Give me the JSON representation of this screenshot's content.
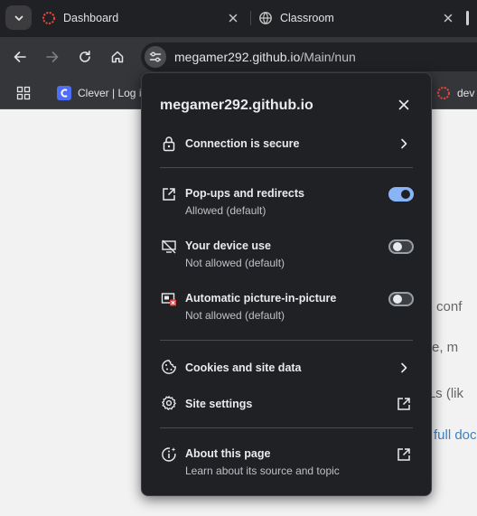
{
  "tabs": [
    {
      "title": "Dashboard",
      "icon": "dashboard-favicon"
    },
    {
      "title": "Classroom",
      "icon": "globe-icon"
    }
  ],
  "toolbar": {
    "url_host": "megamer292.github.io",
    "url_path": "/Main/nun"
  },
  "bookmarks": [
    {
      "label": "Clever | Log in",
      "icon": "clever-favicon"
    },
    {
      "label": "dev",
      "icon": "dashboard-favicon"
    }
  ],
  "page": {
    "lines": [
      "ite conf",
      "site, m",
      "RLs (lik",
      "full doc"
    ]
  },
  "popup": {
    "title": "megamer292.github.io",
    "connection": "Connection is secure",
    "permissions": [
      {
        "title": "Pop-ups and redirects",
        "subtitle": "Allowed (default)",
        "enabled": true,
        "icon": "open-in-new-icon"
      },
      {
        "title": "Your device use",
        "subtitle": "Not allowed (default)",
        "enabled": false,
        "icon": "device-use-off-icon"
      },
      {
        "title": "Automatic picture-in-picture",
        "subtitle": "Not allowed (default)",
        "enabled": false,
        "icon": "picture-in-picture-blocked-icon"
      }
    ],
    "cookies": "Cookies and site data",
    "site_settings": "Site settings",
    "about": {
      "title": "About this page",
      "subtitle": "Learn about its source and topic"
    }
  },
  "colors": {
    "accent": "#8ab4f8",
    "dashboard_favicon": "#e8453c",
    "clever_favicon": "#4f6ef7",
    "popup_bg": "#202124"
  }
}
